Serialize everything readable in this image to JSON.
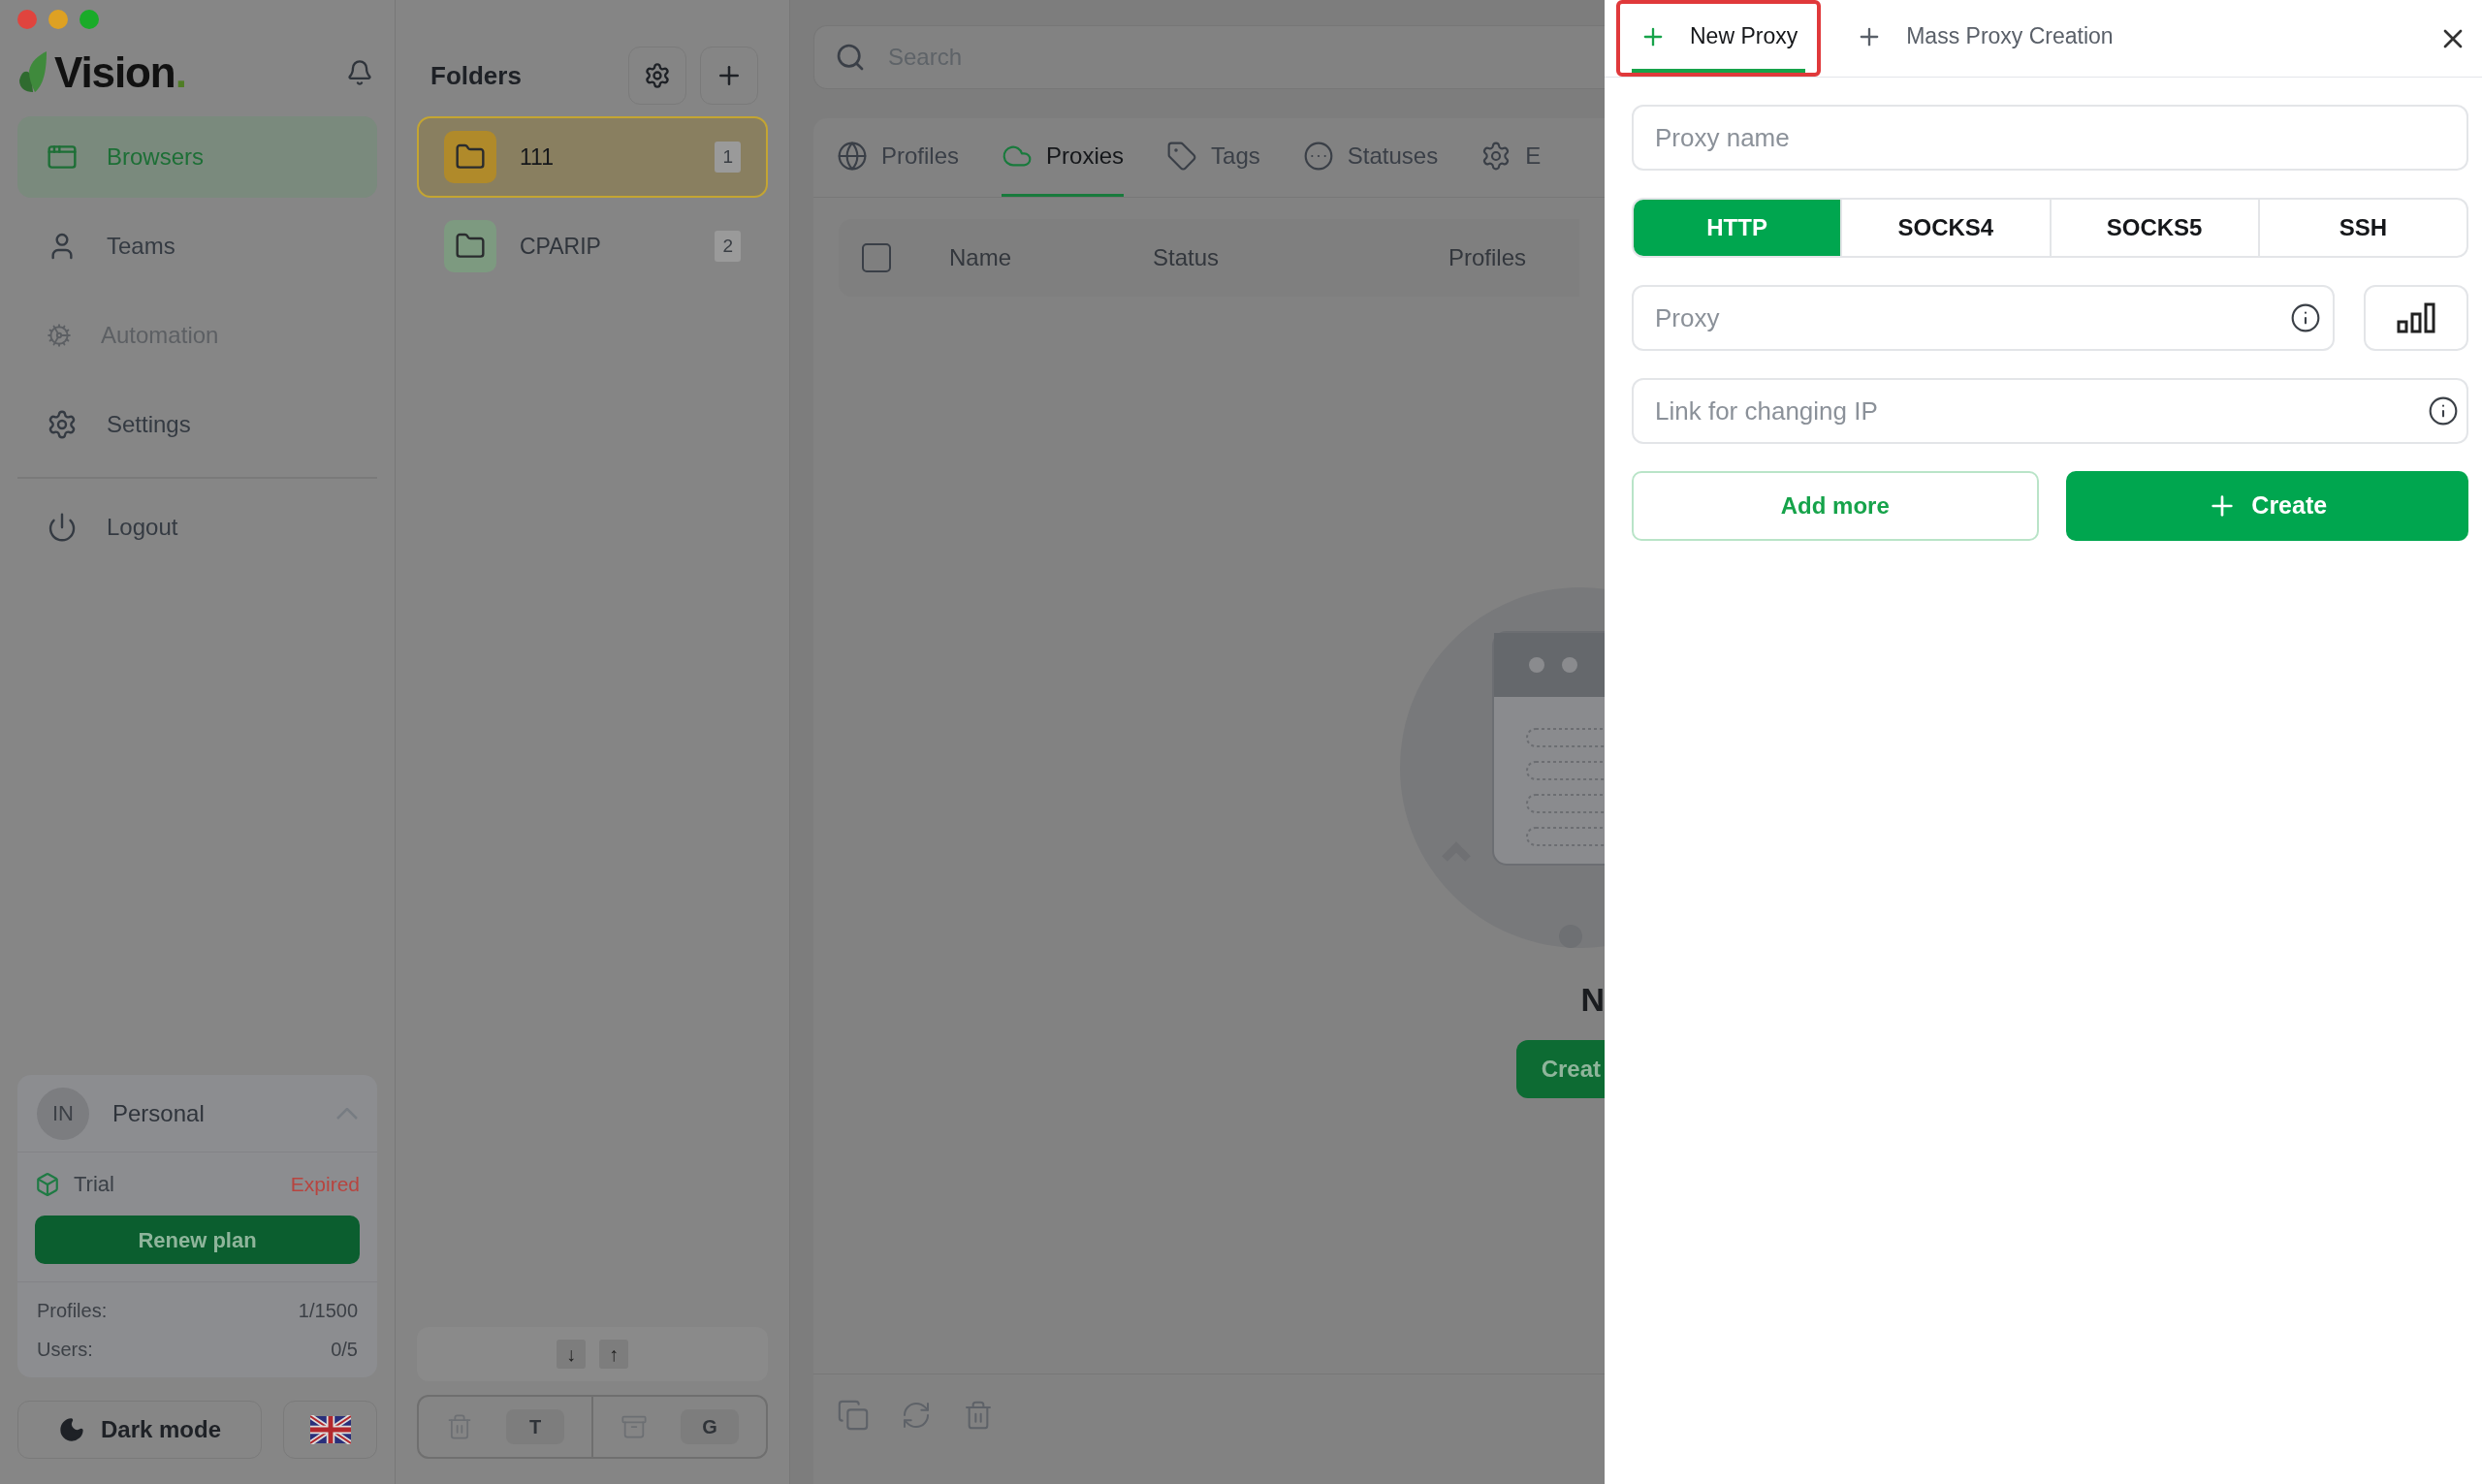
{
  "sidebar": {
    "logo": {
      "name": "Vision",
      "mark": "."
    },
    "nav": [
      {
        "kind": "browsers",
        "label": "Browsers",
        "selected": true,
        "disabled": false
      },
      {
        "kind": "teams",
        "label": "Teams",
        "selected": false,
        "disabled": false
      },
      {
        "kind": "automation",
        "label": "Automation",
        "selected": false,
        "disabled": true
      },
      {
        "kind": "settings",
        "label": "Settings",
        "selected": false,
        "disabled": false
      }
    ],
    "logout": "Logout",
    "account": {
      "initials": "IN",
      "name": "Personal",
      "expanded": true,
      "plan": "Trial",
      "plan_status": "Expired",
      "renew": "Renew plan",
      "stats": [
        {
          "label": "Profiles:",
          "value": "1/1500"
        },
        {
          "label": "Users:",
          "value": "0/5"
        }
      ]
    },
    "dark_mode": "Dark mode"
  },
  "folders": {
    "title": "Folders",
    "items": [
      {
        "name": "111",
        "count": "1",
        "selected": true
      },
      {
        "name": "CPARIP",
        "count": "2",
        "selected": false
      }
    ],
    "sort": [
      "↓",
      "↑"
    ],
    "actions": [
      {
        "kind": "delete",
        "key": "T"
      },
      {
        "kind": "archive",
        "key": "G"
      }
    ]
  },
  "main": {
    "search": {
      "placeholder": "Search"
    },
    "tabs": [
      {
        "kind": "globe",
        "label": "Profiles",
        "selected": false
      },
      {
        "kind": "cloud",
        "label": "Proxies",
        "selected": true
      },
      {
        "kind": "tag",
        "label": "Tags",
        "selected": false
      },
      {
        "kind": "dots",
        "label": "Statuses",
        "selected": false
      },
      {
        "kind": "gear",
        "label": "E",
        "selected": false
      }
    ],
    "table": {
      "all_checked": false,
      "columns": [
        "Name",
        "Status",
        "Profiles"
      ]
    },
    "empty": {
      "title": "N",
      "button": "Creat"
    }
  },
  "drawer": {
    "tabs": [
      {
        "label": "New Proxy",
        "selected": true,
        "highlighted": true
      },
      {
        "label": "Mass Proxy Creation",
        "selected": false,
        "highlighted": false
      }
    ],
    "name": {
      "placeholder": "Proxy name"
    },
    "protocols": [
      {
        "label": "HTTP",
        "selected": true
      },
      {
        "label": "SOCKS4",
        "selected": false
      },
      {
        "label": "SOCKS5",
        "selected": false
      },
      {
        "label": "SSH",
        "selected": false
      }
    ],
    "proxy": {
      "placeholder": "Proxy"
    },
    "link": {
      "placeholder": "Link for changing IP"
    },
    "add_more": "Add more",
    "create": "Create"
  }
}
